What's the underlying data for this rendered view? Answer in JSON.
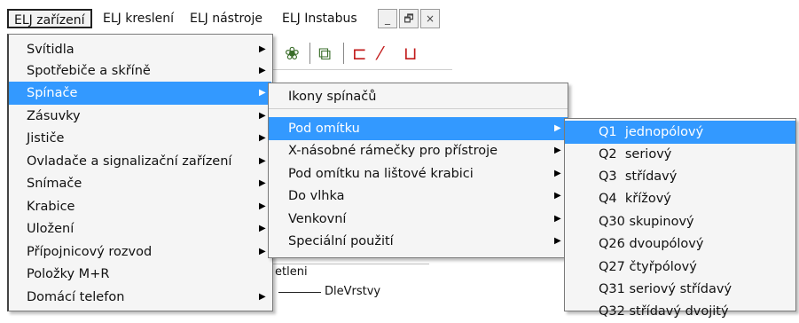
{
  "menubar": {
    "items": [
      "ELJ zařízení",
      "ELJ kreslení",
      "ELJ nástroje",
      "ELJ Instabus"
    ],
    "window_buttons": [
      "_",
      "🗗",
      "×"
    ]
  },
  "background": {
    "panel_text_1": "etleni",
    "panel_text_2": "DleVrstvy"
  },
  "menu1": {
    "items": [
      {
        "label": "Svítidla",
        "arrow": "▶"
      },
      {
        "label": "Spotřebiče a skříně",
        "arrow": "▶"
      },
      {
        "label": "Spínače",
        "arrow": "▶"
      },
      {
        "label": "Zásuvky",
        "arrow": "▶"
      },
      {
        "label": "Jističe",
        "arrow": "▶"
      },
      {
        "label": "Ovladače a signalizační zařízení",
        "arrow": "▶"
      },
      {
        "label": "Snímače",
        "arrow": "▶"
      },
      {
        "label": "Krabice",
        "arrow": "▶"
      },
      {
        "label": "Uložení",
        "arrow": "▶"
      },
      {
        "label": "Přípojnicový rozvod",
        "arrow": "▶"
      },
      {
        "label": "Položky M+R",
        "arrow": ""
      },
      {
        "label": "Domácí telefon",
        "arrow": "▶"
      }
    ],
    "highlighted_index": 2
  },
  "menu2": {
    "items": [
      {
        "label": "Ikony spínačů",
        "arrow": ""
      },
      {
        "label": "Pod omítku",
        "arrow": "▶"
      },
      {
        "label": "X-násobné rámečky pro přístroje",
        "arrow": "▶"
      },
      {
        "label": "Pod omítku na lištové krabici",
        "arrow": "▶"
      },
      {
        "label": "Do vlhka",
        "arrow": "▶"
      },
      {
        "label": "Venkovní",
        "arrow": "▶"
      },
      {
        "label": "Speciální použití",
        "arrow": "▶"
      }
    ],
    "highlighted_index": 1
  },
  "menu3": {
    "items": [
      {
        "label": "Q1  jednopólový"
      },
      {
        "label": "Q2  seriový"
      },
      {
        "label": "Q3  střídavý"
      },
      {
        "label": "Q4  křížový"
      },
      {
        "label": "Q30 skupinový"
      },
      {
        "label": "Q26 dvoupólový"
      },
      {
        "label": "Q27 čtyřpólový"
      },
      {
        "label": "Q31 seriový střídavý"
      },
      {
        "label": "Q32 střídavý dvojitý"
      }
    ],
    "highlighted_index": 0
  },
  "colors": {
    "highlight": "#3399ff",
    "menu_bg": "#f5f5f5"
  }
}
